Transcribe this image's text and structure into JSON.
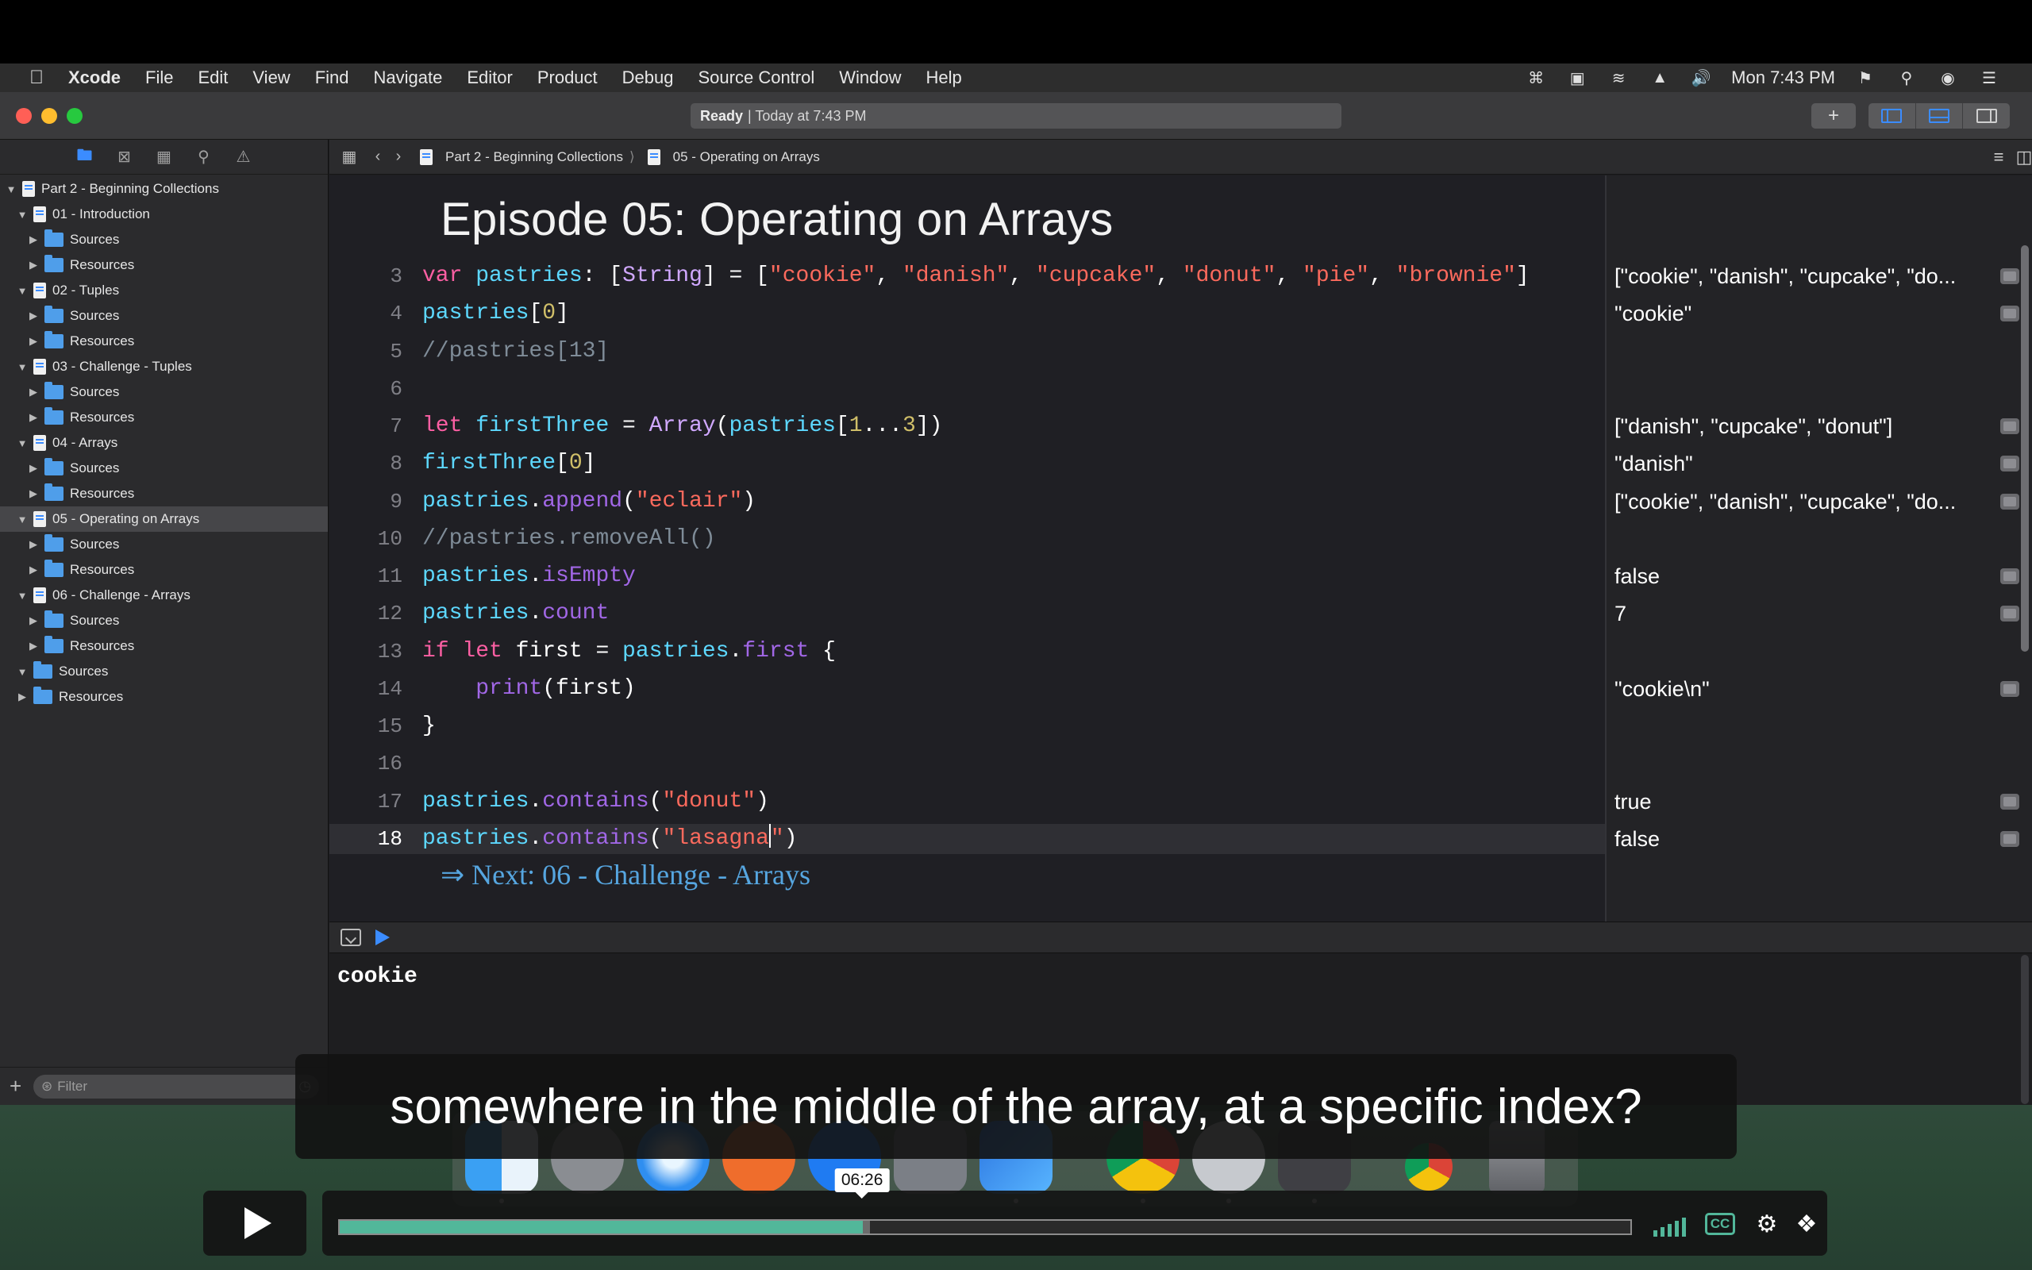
{
  "menubar": {
    "app": "Xcode",
    "items": [
      "File",
      "Edit",
      "View",
      "Find",
      "Navigate",
      "Editor",
      "Product",
      "Debug",
      "Source Control",
      "Window",
      "Help"
    ],
    "clock": "Mon 7:43 PM"
  },
  "toolbar": {
    "status_bold": "Ready",
    "status_rest": "| Today at 7:43 PM",
    "add_label": "+"
  },
  "jumpbar": {
    "crumb1": "Part 2 - Beginning Collections",
    "crumb2": "05 - Operating on Arrays"
  },
  "navigator": {
    "filter_placeholder": "Filter",
    "tree": [
      {
        "label": "Part 2 - Beginning Collections",
        "kind": "file",
        "indent": 0,
        "open": true
      },
      {
        "label": "01 - Introduction",
        "kind": "file",
        "indent": 1,
        "open": true
      },
      {
        "label": "Sources",
        "kind": "folder",
        "indent": 2,
        "open": false
      },
      {
        "label": "Resources",
        "kind": "folder",
        "indent": 2,
        "open": false
      },
      {
        "label": "02 - Tuples",
        "kind": "file",
        "indent": 1,
        "open": true
      },
      {
        "label": "Sources",
        "kind": "folder",
        "indent": 2,
        "open": false
      },
      {
        "label": "Resources",
        "kind": "folder",
        "indent": 2,
        "open": false
      },
      {
        "label": "03 - Challenge - Tuples",
        "kind": "file",
        "indent": 1,
        "open": true
      },
      {
        "label": "Sources",
        "kind": "folder",
        "indent": 2,
        "open": false
      },
      {
        "label": "Resources",
        "kind": "folder",
        "indent": 2,
        "open": false
      },
      {
        "label": "04 - Arrays",
        "kind": "file",
        "indent": 1,
        "open": true
      },
      {
        "label": "Sources",
        "kind": "folder",
        "indent": 2,
        "open": false
      },
      {
        "label": "Resources",
        "kind": "folder",
        "indent": 2,
        "open": false
      },
      {
        "label": "05 - Operating on Arrays",
        "kind": "file",
        "indent": 1,
        "open": true,
        "selected": true
      },
      {
        "label": "Sources",
        "kind": "folder",
        "indent": 2,
        "open": false
      },
      {
        "label": "Resources",
        "kind": "folder",
        "indent": 2,
        "open": false
      },
      {
        "label": "06 - Challenge - Arrays",
        "kind": "file",
        "indent": 1,
        "open": true
      },
      {
        "label": "Sources",
        "kind": "folder",
        "indent": 2,
        "open": false
      },
      {
        "label": "Resources",
        "kind": "folder",
        "indent": 2,
        "open": false
      },
      {
        "label": "Sources",
        "kind": "folder",
        "indent": 1,
        "open": true
      },
      {
        "label": "Resources",
        "kind": "folder",
        "indent": 1,
        "open": false
      }
    ]
  },
  "editor": {
    "title": "Episode 05: Operating on Arrays",
    "next_link": "⇒ Next: 06 - Challenge - Arrays",
    "lines": [
      {
        "n": "3",
        "tokens": [
          [
            "kw",
            "var "
          ],
          [
            "id",
            "pastries"
          ],
          [
            "pl",
            ": ["
          ],
          [
            "ty",
            "String"
          ],
          [
            "pl",
            "] = ["
          ],
          [
            "st",
            "\"cookie\""
          ],
          [
            "pl",
            ", "
          ],
          [
            "st",
            "\"danish\""
          ],
          [
            "pl",
            ", "
          ],
          [
            "st",
            "\"cupcake\""
          ],
          [
            "pl",
            ", "
          ],
          [
            "st",
            "\"donut\""
          ],
          [
            "pl",
            ", "
          ],
          [
            "st",
            "\"pie\""
          ],
          [
            "pl",
            ", "
          ],
          [
            "st",
            "\"brownie\""
          ],
          [
            "pl",
            "]"
          ]
        ]
      },
      {
        "n": "4",
        "tokens": [
          [
            "id",
            "pastries"
          ],
          [
            "pl",
            "["
          ],
          [
            "nm",
            "0"
          ],
          [
            "pl",
            "]"
          ]
        ]
      },
      {
        "n": "5",
        "tokens": [
          [
            "cm",
            "//pastries[13]"
          ]
        ]
      },
      {
        "n": "6",
        "tokens": []
      },
      {
        "n": "7",
        "tokens": [
          [
            "kw",
            "let "
          ],
          [
            "id",
            "firstThree"
          ],
          [
            "pl",
            " = "
          ],
          [
            "ty",
            "Array"
          ],
          [
            "pl",
            "("
          ],
          [
            "id",
            "pastries"
          ],
          [
            "pl",
            "["
          ],
          [
            "nm",
            "1"
          ],
          [
            "pl",
            "..."
          ],
          [
            "nm",
            "3"
          ],
          [
            "pl",
            "])"
          ]
        ]
      },
      {
        "n": "8",
        "tokens": [
          [
            "id",
            "firstThree"
          ],
          [
            "pl",
            "["
          ],
          [
            "nm",
            "0"
          ],
          [
            "pl",
            "]"
          ]
        ]
      },
      {
        "n": "9",
        "tokens": [
          [
            "id",
            "pastries"
          ],
          [
            "pl",
            "."
          ],
          [
            "mt",
            "append"
          ],
          [
            "pl",
            "("
          ],
          [
            "st",
            "\"eclair\""
          ],
          [
            "pl",
            ")"
          ]
        ]
      },
      {
        "n": "10",
        "tokens": [
          [
            "cm",
            "//pastries.removeAll()"
          ]
        ]
      },
      {
        "n": "11",
        "tokens": [
          [
            "id",
            "pastries"
          ],
          [
            "pl",
            "."
          ],
          [
            "mt",
            "isEmpty"
          ]
        ]
      },
      {
        "n": "12",
        "tokens": [
          [
            "id",
            "pastries"
          ],
          [
            "pl",
            "."
          ],
          [
            "mt",
            "count"
          ]
        ]
      },
      {
        "n": "13",
        "tokens": [
          [
            "kw",
            "if let "
          ],
          [
            "pl",
            "first = "
          ],
          [
            "id",
            "pastries"
          ],
          [
            "pl",
            "."
          ],
          [
            "mt",
            "first"
          ],
          [
            "pl",
            " {"
          ]
        ]
      },
      {
        "n": "14",
        "tokens": [
          [
            "pl",
            "    "
          ],
          [
            "mt",
            "print"
          ],
          [
            "pl",
            "(first)"
          ]
        ]
      },
      {
        "n": "15",
        "tokens": [
          [
            "pl",
            "}"
          ]
        ]
      },
      {
        "n": "16",
        "tokens": []
      },
      {
        "n": "17",
        "tokens": [
          [
            "id",
            "pastries"
          ],
          [
            "pl",
            "."
          ],
          [
            "mt",
            "contains"
          ],
          [
            "pl",
            "("
          ],
          [
            "st",
            "\"donut\""
          ],
          [
            "pl",
            ")"
          ]
        ]
      },
      {
        "n": "18",
        "tokens": [
          [
            "id",
            "pastries"
          ],
          [
            "pl",
            "."
          ],
          [
            "mt",
            "contains"
          ],
          [
            "pl",
            "("
          ],
          [
            "st",
            "\"lasagna"
          ],
          [
            "cursor",
            ""
          ],
          [
            "st",
            "\""
          ],
          [
            "pl",
            ")"
          ]
        ],
        "current": true
      }
    ]
  },
  "results": [
    {
      "line": 3,
      "value": "[\"cookie\", \"danish\", \"cupcake\", \"do..."
    },
    {
      "line": 4,
      "value": "\"cookie\""
    },
    {
      "line": 7,
      "value": "[\"danish\", \"cupcake\", \"donut\"]"
    },
    {
      "line": 8,
      "value": "\"danish\""
    },
    {
      "line": 9,
      "value": "[\"cookie\", \"danish\", \"cupcake\", \"do..."
    },
    {
      "line": 11,
      "value": "false"
    },
    {
      "line": 12,
      "value": "7"
    },
    {
      "line": 14,
      "value": "\"cookie\\n\""
    },
    {
      "line": 17,
      "value": "true"
    },
    {
      "line": 18,
      "value": "false"
    }
  ],
  "console": {
    "output": "cookie"
  },
  "subtitle": "somewhere in the middle of the array, at a specific index?",
  "player": {
    "time": "06:26",
    "played_fraction": 0.405,
    "buffered_fraction": 0.411,
    "cc_label": "CC"
  },
  "colors": {
    "accent": "#3b8cff",
    "player_accent": "#52b79a",
    "editor_bg": "#1f1f24"
  }
}
